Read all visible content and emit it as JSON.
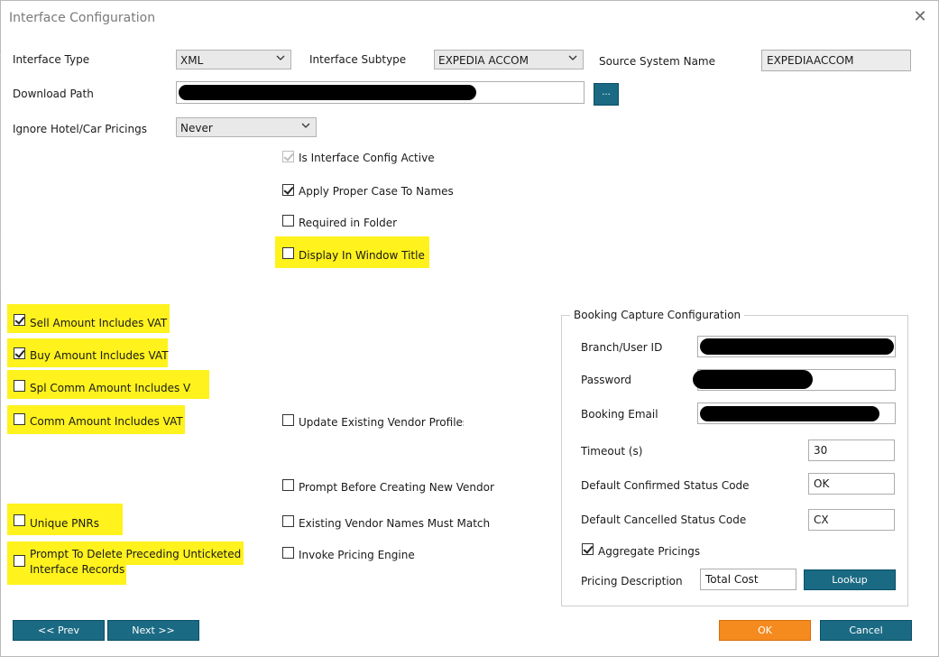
{
  "window": {
    "title": "Interface Configuration",
    "close_glyph": "✕"
  },
  "interface_type": {
    "label": "Interface Type",
    "value": "XML"
  },
  "interface_subtype": {
    "label": "Interface Subtype",
    "value": "EXPEDIA ACCOM"
  },
  "source_system_name": {
    "label": "Source System Name",
    "value": "EXPEDIAACCOM"
  },
  "download_path": {
    "label": "Download Path",
    "browse_label": "..."
  },
  "ignore_pricings": {
    "label": "Ignore Hotel/Car Pricings",
    "value": "Never"
  },
  "options_top": [
    {
      "label": "Is Interface Config Active",
      "checked": true,
      "disabled": true
    },
    {
      "label": "Apply Proper Case To Names",
      "checked": true
    },
    {
      "label": "Required in Folder",
      "checked": false
    },
    {
      "label": "Display In Window Title",
      "checked": false
    }
  ],
  "vat_options": [
    {
      "label": "Sell Amount Includes VAT",
      "checked": true
    },
    {
      "label": "Buy Amount Includes VAT",
      "checked": true
    },
    {
      "label": "Spl Comm Amount Includes VA",
      "checked": false
    },
    {
      "label": "Comm Amount Includes VAT",
      "checked": false
    }
  ],
  "vendor_options": [
    {
      "label": "Update Existing Vendor Profiles",
      "checked": false
    },
    {
      "label": "Prompt Before Creating New Vendor",
      "checked": false
    },
    {
      "label": "Existing Vendor Names Must Match",
      "checked": false
    },
    {
      "label": "Invoke Pricing Engine",
      "checked": false
    }
  ],
  "unique_pnrs": {
    "label": "Unique PNRs",
    "checked": false
  },
  "prompt_delete": {
    "label_line1": "Prompt To Delete Preceding Unticketed",
    "label_line2": "Interface Records",
    "checked": false
  },
  "booking_capture": {
    "title": "Booking Capture Configuration",
    "branch_user_id_label": "Branch/User ID",
    "password_label": "Password",
    "booking_email_label": "Booking Email",
    "timeout_label": "Timeout (s)",
    "timeout_value": "30",
    "confirmed_label": "Default Confirmed Status Code",
    "confirmed_value": "OK",
    "cancelled_label": "Default Cancelled Status Code",
    "cancelled_value": "CX",
    "aggregate_label": "Aggregate Pricings",
    "aggregate_checked": true,
    "pricing_desc_label": "Pricing Description",
    "pricing_desc_value": "Total Cost",
    "lookup_label": "Lookup"
  },
  "footer": {
    "prev_label": "<< Prev",
    "next_label": "Next >>",
    "ok_label": "OK",
    "cancel_label": "Cancel"
  },
  "colors": {
    "highlight": "#fff21d",
    "primary_button": "#1b6a83",
    "ok_button": "#f58a1f"
  }
}
